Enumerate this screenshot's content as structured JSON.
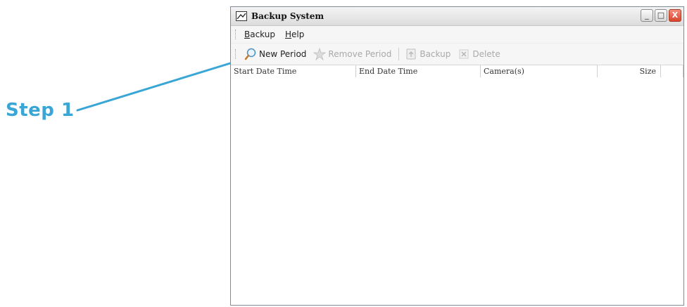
{
  "annotation": {
    "label": "Step 1",
    "color": "#3aa6d6"
  },
  "window": {
    "title": "Backup System",
    "controls": {
      "minimize": "_",
      "maximize": "□",
      "close": "X"
    }
  },
  "menu": {
    "items": [
      {
        "label": "Backup",
        "accel": "B"
      },
      {
        "label": "Help",
        "accel": "H"
      }
    ]
  },
  "toolbar": {
    "buttons": [
      {
        "label": "New Period",
        "icon": "magnifier-icon",
        "enabled": true
      },
      {
        "label": "Remove Period",
        "icon": "remove-star-icon",
        "enabled": false
      },
      {
        "label": "Backup",
        "icon": "backup-icon",
        "enabled": false
      },
      {
        "label": "Delete",
        "icon": "delete-x-icon",
        "enabled": false
      }
    ]
  },
  "table": {
    "columns": [
      "Start Date Time",
      "End Date Time",
      "Camera(s)",
      "Size"
    ],
    "rows": []
  }
}
